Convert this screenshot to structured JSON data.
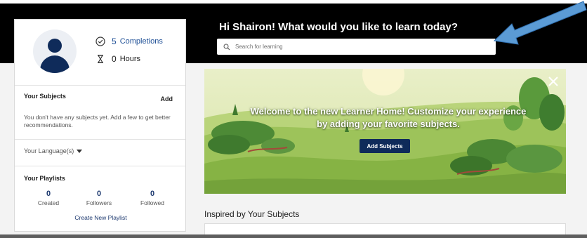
{
  "profile": {
    "completions_count": "5",
    "completions_label": "Completions",
    "hours_count": "0",
    "hours_label": "Hours"
  },
  "subjects": {
    "title": "Your Subjects",
    "add_label": "Add",
    "empty_message": "You don't have any subjects yet. Add a few to get better recommendations."
  },
  "language": {
    "label": "Your Language(s)"
  },
  "playlists": {
    "title": "Your Playlists",
    "stats": [
      {
        "value": "0",
        "label": "Created"
      },
      {
        "value": "0",
        "label": "Followers"
      },
      {
        "value": "0",
        "label": "Followed"
      }
    ],
    "create_label": "Create New Playlist"
  },
  "hero": {
    "greeting": "Hi Shairon! What would you like to learn today?",
    "search_placeholder": "Search for learning"
  },
  "banner": {
    "welcome_text": "Welcome to the new Learner Home! Customize your experience by adding your favorite subjects.",
    "button_label": "Add Subjects"
  },
  "recommendations": {
    "title": "Inspired by Your Subjects"
  },
  "colors": {
    "header_bg": "#000000",
    "primary_navy": "#0f2b5a",
    "link_blue": "#1e4f96",
    "annotation_arrow": "#5b9bd5"
  },
  "icons": {
    "completions": "check-circle-icon",
    "hours": "hourglass-icon",
    "search": "search-icon",
    "close": "close-icon",
    "language_caret": "caret-down-icon"
  }
}
